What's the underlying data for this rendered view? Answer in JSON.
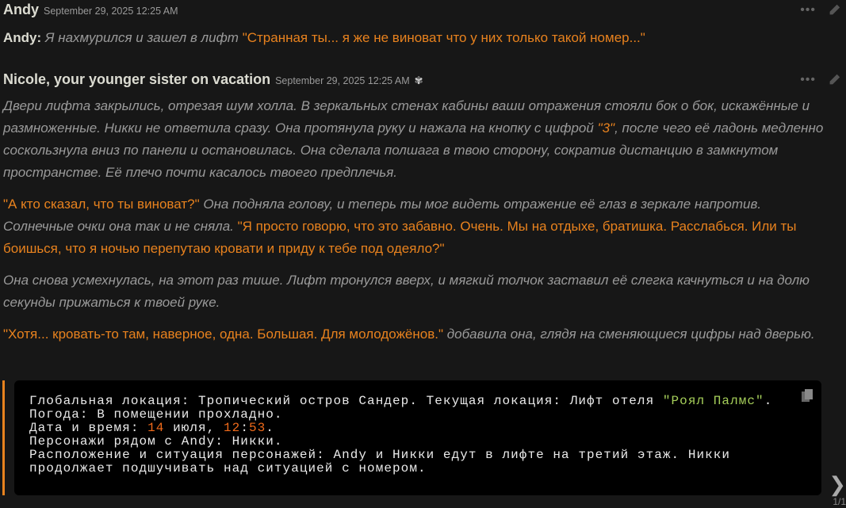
{
  "messages": [
    {
      "author": "Andy",
      "timestamp": "September 29, 2025 12:25 AM",
      "prefix": "Andy:",
      "action": "Я нахмурился и зашел в лифт",
      "speech": "\"Странная ты... я же не виноват что у них только такой номер...\""
    },
    {
      "author": "Nicole, your younger sister on vacation",
      "timestamp": "September 29, 2025 12:25 AM",
      "p1a": "Двери лифта закрылись, отрезая шум холла. В зеркальных стенах кабины ваши отражения стояли бок о бок, искажённые и размноженные. Никки не ответила сразу. Она протянула руку и нажала на кнопку с цифрой ",
      "p1q": "\"3\"",
      "p1b": ", после чего её ладонь медленно соскользнула вниз по панели и остановилась. Она сделала полшага в твою сторону, сократив дистанцию в замкнутом пространстве. Её плечо почти касалось твоего предплечья.",
      "p2q1": "\"А кто сказал, что ты виноват?\"",
      "p2a": " Она подняла голову, и теперь ты мог видеть отражение её глаз в зеркале напротив. Солнечные очки она так и не сняла. ",
      "p2q2": "\"Я просто говорю, что это забавно. Очень. Мы на отдыхе, братишка. Расслабься. Или ты боишься, что я ночью перепутаю кровати и приду к тебе под одеяло?\"",
      "p3": "Она снова усмехнулась, на этот раз тише. Лифт тронулся вверх, и мягкий толчок заставил её слегка качнуться и на долю секунды прижаться к твоей руке.",
      "p4q": "\"Хотя... кровать-то там, наверное, одна. Большая. Для молодожёнов.\"",
      "p4a": " добавила она, глядя на сменяющиеся цифры над дверью."
    }
  ],
  "actions": {
    "more": "•••"
  },
  "code": {
    "l1a": "Глобальная локация: Тропический остров Сандер. Текущая локация: Лифт отеля ",
    "l1g": "\"Роял Палмс\"",
    "l1b": ".",
    "l2": "Погода: В помещении прохладно.",
    "l3a": "Дата и время: ",
    "l3n1": "14",
    "l3b": " июля, ",
    "l3n2": "12",
    "l3c": ":",
    "l3n3": "53",
    "l3d": ".",
    "l4": "Персонажи рядом с Andy: Никки.",
    "l5": "Расположение и ситуация персонажей: Andy и Никки едут в лифте на третий этаж. Никки",
    "l6": "продолжает подшучивать над ситуацией с номером."
  },
  "swipe": {
    "arrow": "❯",
    "counter": "1/1"
  }
}
